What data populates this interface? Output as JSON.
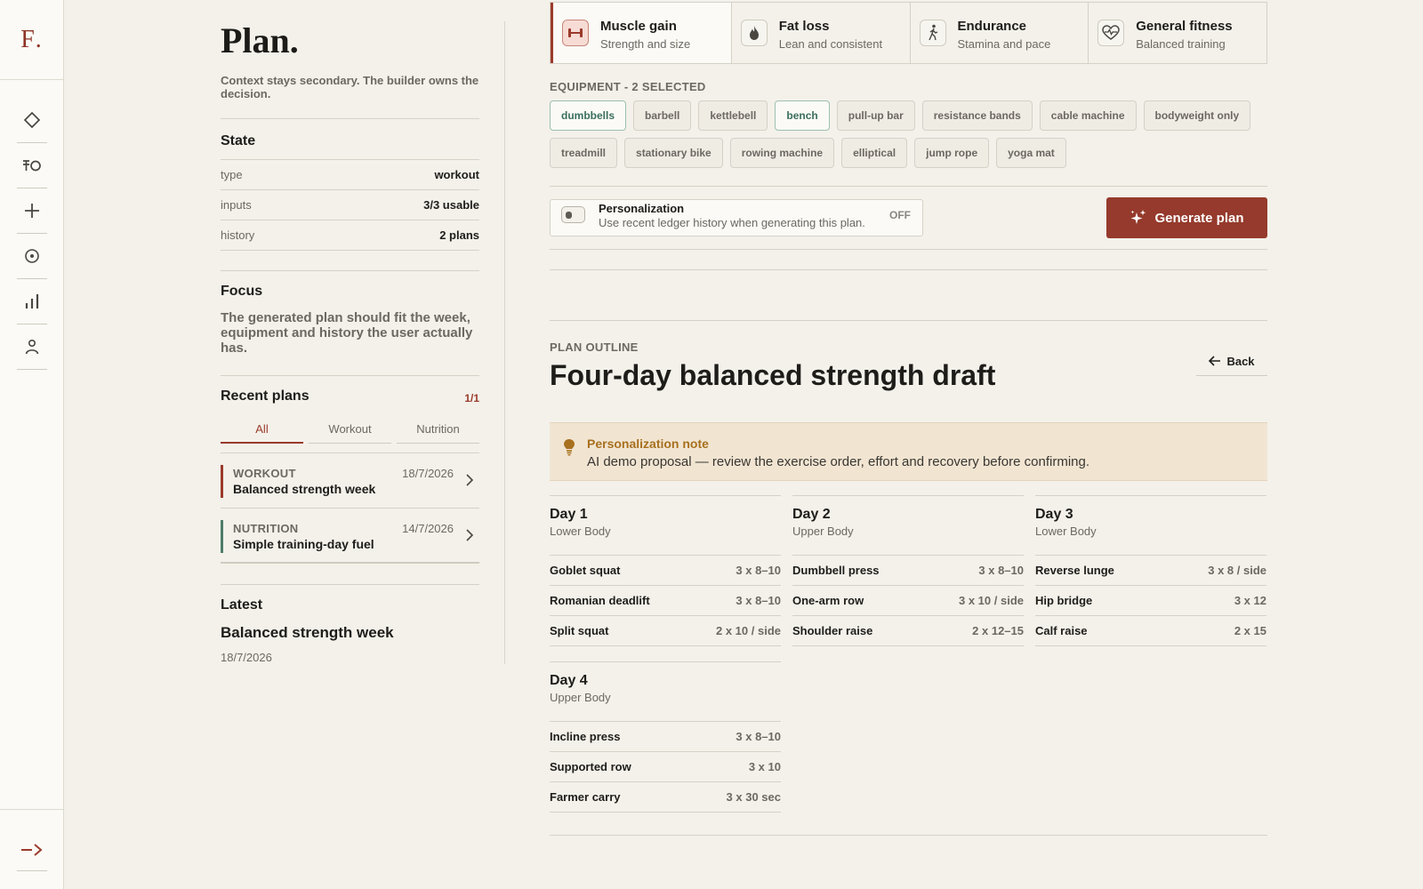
{
  "rail": {
    "logo": "F",
    "items": [
      {
        "icon": "diamond-icon"
      },
      {
        "icon": "dumbbell-circle-icon"
      },
      {
        "icon": "plus-icon"
      },
      {
        "icon": "target-icon"
      },
      {
        "icon": "bar-chart-icon"
      },
      {
        "icon": "user-icon"
      }
    ],
    "logout_icon": "logout-arrow-icon"
  },
  "context": {
    "title": "Plan.",
    "subtitle": "Context stays secondary. The builder owns the decision.",
    "state": {
      "heading": "State",
      "rows": [
        {
          "key": "type",
          "value": "workout"
        },
        {
          "key": "inputs",
          "value": "3/3 usable"
        },
        {
          "key": "history",
          "value": "2 plans"
        }
      ]
    },
    "focus": {
      "heading": "Focus",
      "text": "The generated plan should fit the week, equipment and history the user actually has."
    },
    "recent": {
      "heading": "Recent plans",
      "count": "1/1",
      "tabs": [
        "All",
        "Workout",
        "Nutrition"
      ],
      "active_tab": "All",
      "items": [
        {
          "category": "WORKOUT",
          "date": "18/7/2026",
          "name": "Balanced strength week",
          "color": "#9b3a2b"
        },
        {
          "category": "NUTRITION",
          "date": "14/7/2026",
          "name": "Simple training-day fuel",
          "color": "#4d7d6a"
        }
      ]
    },
    "latest": {
      "heading": "Latest",
      "name": "Balanced strength week",
      "date": "18/7/2026"
    }
  },
  "builder": {
    "goals": [
      {
        "title": "Muscle gain",
        "subtitle": "Strength and size",
        "icon": "dumbbell-icon",
        "active": true
      },
      {
        "title": "Fat loss",
        "subtitle": "Lean and consistent",
        "icon": "flame-icon",
        "active": false
      },
      {
        "title": "Endurance",
        "subtitle": "Stamina and pace",
        "icon": "walker-icon",
        "active": false
      },
      {
        "title": "General fitness",
        "subtitle": "Balanced training",
        "icon": "heart-pulse-icon",
        "active": false
      }
    ],
    "equipment_label": "EQUIPMENT - 2 SELECTED",
    "equipment": [
      {
        "label": "dumbbells",
        "selected": true
      },
      {
        "label": "barbell",
        "selected": false
      },
      {
        "label": "kettlebell",
        "selected": false
      },
      {
        "label": "bench",
        "selected": true
      },
      {
        "label": "pull-up bar",
        "selected": false
      },
      {
        "label": "resistance bands",
        "selected": false
      },
      {
        "label": "cable machine",
        "selected": false
      },
      {
        "label": "bodyweight only",
        "selected": false
      },
      {
        "label": "treadmill",
        "selected": false
      },
      {
        "label": "stationary bike",
        "selected": false
      },
      {
        "label": "rowing machine",
        "selected": false
      },
      {
        "label": "elliptical",
        "selected": false
      },
      {
        "label": "jump rope",
        "selected": false
      },
      {
        "label": "yoga mat",
        "selected": false
      }
    ],
    "personalization": {
      "title": "Personalization",
      "description": "Use recent ledger history when generating this plan.",
      "state": "OFF"
    },
    "generate_label": "Generate plan",
    "accent": "#953a2c"
  },
  "outline": {
    "label": "PLAN OUTLINE",
    "title": "Four-day balanced strength draft",
    "back_label": "Back",
    "note": {
      "title": "Personalization note",
      "text": "AI demo proposal — review the exercise order, effort and recovery before confirming."
    },
    "days": [
      {
        "title": "Day 1",
        "focus": "Lower Body",
        "exercises": [
          {
            "name": "Goblet squat",
            "sets": "3 x 8–10"
          },
          {
            "name": "Romanian deadlift",
            "sets": "3 x 8–10"
          },
          {
            "name": "Split squat",
            "sets": "2 x 10 / side"
          }
        ]
      },
      {
        "title": "Day 2",
        "focus": "Upper Body",
        "exercises": [
          {
            "name": "Dumbbell press",
            "sets": "3 x 8–10"
          },
          {
            "name": "One-arm row",
            "sets": "3 x 10 / side"
          },
          {
            "name": "Shoulder raise",
            "sets": "2 x 12–15"
          }
        ]
      },
      {
        "title": "Day 3",
        "focus": "Lower Body",
        "exercises": [
          {
            "name": "Reverse lunge",
            "sets": "3 x 8 / side"
          },
          {
            "name": "Hip bridge",
            "sets": "3 x 12"
          },
          {
            "name": "Calf raise",
            "sets": "2 x 15"
          }
        ]
      },
      {
        "title": "Day 4",
        "focus": "Upper Body",
        "exercises": [
          {
            "name": "Incline press",
            "sets": "3 x 8–10"
          },
          {
            "name": "Supported row",
            "sets": "3 x 10"
          },
          {
            "name": "Farmer carry",
            "sets": "3 x 30 sec"
          }
        ]
      }
    ]
  }
}
